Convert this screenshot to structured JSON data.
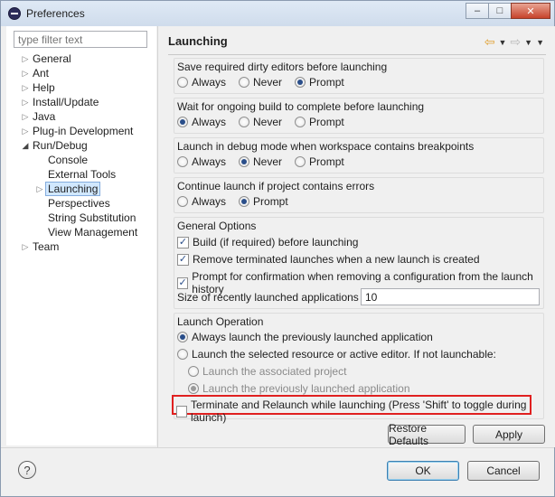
{
  "window": {
    "title": "Preferences",
    "minimize_glyph": "–",
    "restore_glyph": "□",
    "close_glyph": "✕"
  },
  "filter": {
    "placeholder": "type filter text"
  },
  "tree": [
    {
      "label": "General",
      "expander": "▷"
    },
    {
      "label": "Ant",
      "expander": "▷"
    },
    {
      "label": "Help",
      "expander": "▷"
    },
    {
      "label": "Install/Update",
      "expander": "▷"
    },
    {
      "label": "Java",
      "expander": "▷"
    },
    {
      "label": "Plug-in Development",
      "expander": "▷"
    },
    {
      "label": "Run/Debug",
      "expander": "◢"
    },
    {
      "label": "Console",
      "expander": ""
    },
    {
      "label": "External Tools",
      "expander": ""
    },
    {
      "label": "Launching",
      "expander": "▷"
    },
    {
      "label": "Perspectives",
      "expander": ""
    },
    {
      "label": "String Substitution",
      "expander": ""
    },
    {
      "label": "View Management",
      "expander": ""
    },
    {
      "label": "Team",
      "expander": "▷"
    }
  ],
  "page": {
    "title": "Launching",
    "nav_back": "⇦",
    "nav_forward": "⇨",
    "dropdown": "▼"
  },
  "groups": {
    "save_dirty": {
      "title": "Save required dirty editors before launching",
      "options": [
        "Always",
        "Never",
        "Prompt"
      ],
      "selected": "Prompt"
    },
    "wait_build": {
      "title": "Wait for ongoing build to complete before launching",
      "options": [
        "Always",
        "Never",
        "Prompt"
      ],
      "selected": "Always"
    },
    "debug_mode": {
      "title": "Launch in debug mode when workspace contains breakpoints",
      "options": [
        "Always",
        "Never",
        "Prompt"
      ],
      "selected": "Never"
    },
    "continue_errors": {
      "title": "Continue launch if project contains errors",
      "options": [
        "Always",
        "Prompt"
      ],
      "selected": "Prompt"
    },
    "general_options": {
      "title": "General Options",
      "checks": [
        {
          "label": "Build (if required) before launching",
          "checked": true
        },
        {
          "label": "Remove terminated launches when a new launch is created",
          "checked": true
        },
        {
          "label": "Prompt for confirmation when removing a configuration from the launch history",
          "checked": true
        }
      ],
      "size_label": "Size of recently launched applications list:",
      "size_value": "10"
    },
    "launch_operation": {
      "title": "Launch Operation",
      "options": [
        {
          "label": "Always launch the previously launched application",
          "selected": true,
          "enabled": true
        },
        {
          "label": "Launch the selected resource or active editor. If not launchable:",
          "selected": false,
          "enabled": true
        },
        {
          "label": "Launch the associated project",
          "selected": false,
          "enabled": false
        },
        {
          "label": "Launch the previously launched application",
          "selected": true,
          "enabled": false
        }
      ],
      "terminate_label": "Terminate and Relaunch while launching (Press 'Shift' to toggle during launch)",
      "terminate_checked": false
    }
  },
  "buttons": {
    "restore_defaults": "Restore Defaults",
    "apply": "Apply",
    "ok": "OK",
    "cancel": "Cancel",
    "help": "?"
  },
  "colors": {
    "highlight_border": "#e02020",
    "selection_bg": "#d1e8ff"
  }
}
